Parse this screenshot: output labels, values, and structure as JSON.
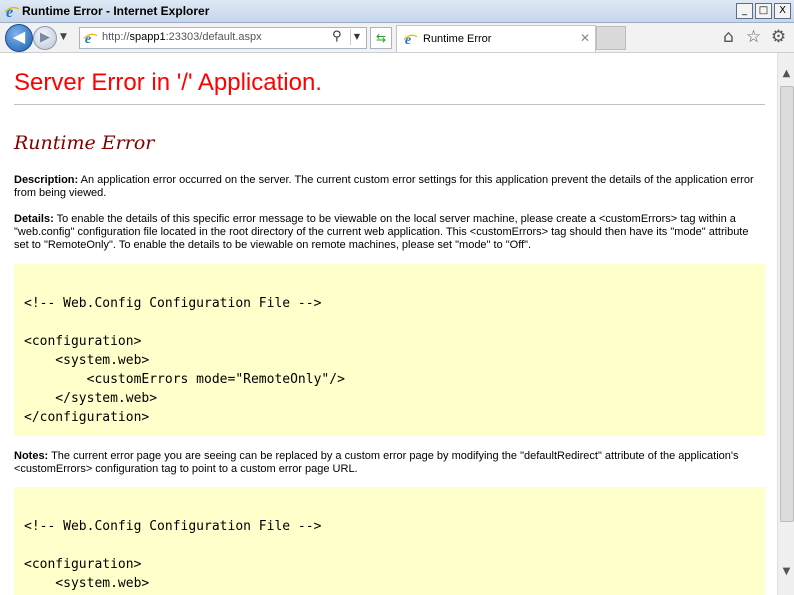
{
  "window": {
    "title": "Runtime Error - Internet Explorer",
    "minimize": "_",
    "restore": "□",
    "close": "X"
  },
  "navbar": {
    "address_prefix": "http://",
    "address_host": "spapp1",
    "address_rest": ":23303/default.aspx",
    "tab_label": "Runtime Error"
  },
  "page": {
    "heading": "Server Error in '/' Application.",
    "subheading": "Runtime Error",
    "description_label": "Description:",
    "description_text": " An application error occurred on the server. The current custom error settings for this application prevent the details of the application error from being viewed.",
    "details_label": "Details:",
    "details_text": " To enable the details of this specific error message to be viewable on the local server machine, please create a <customErrors> tag within a \"web.config\" configuration file located in the root directory of the current web application. This <customErrors> tag should then have its \"mode\" attribute set to \"RemoteOnly\". To enable the details to be viewable on remote machines, please set \"mode\" to \"Off\".",
    "code1": "<!-- Web.Config Configuration File -->\n\n<configuration>\n    <system.web>\n        <customErrors mode=\"RemoteOnly\"/>\n    </system.web>\n</configuration>",
    "notes_label": "Notes:",
    "notes_text": " The current error page you are seeing can be replaced by a custom error page by modifying the \"defaultRedirect\" attribute of the application's <customErrors> configuration tag to point to a custom error page URL.",
    "code2": "<!-- Web.Config Configuration File -->\n\n<configuration>\n    <system.web>"
  },
  "colors": {
    "heading": "#ff0000",
    "subheading": "#800000",
    "code_background": "#ffffcc"
  },
  "icons": [
    "ie-logo-icon",
    "back-arrow-icon",
    "forward-arrow-icon",
    "search-icon",
    "refresh-icon",
    "home-icon",
    "favorites-star-icon",
    "settings-gear-icon"
  ]
}
